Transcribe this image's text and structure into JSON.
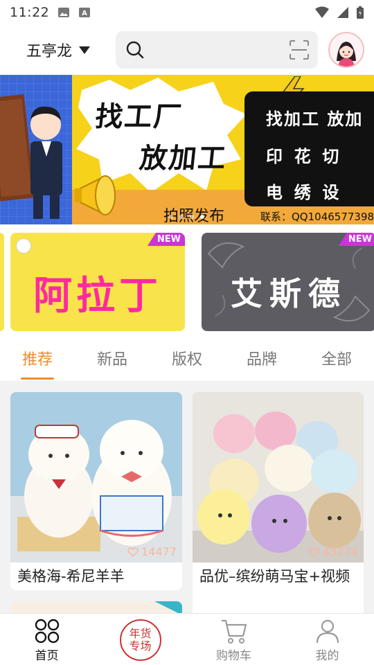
{
  "status_bar": {
    "time": "11:22"
  },
  "header": {
    "location": "五亭龙",
    "search_placeholder": ""
  },
  "banner": {
    "line1": "找工厂",
    "line2": "放加工",
    "caption": "拍照发布",
    "contact": "联系：QQ1046577398",
    "box_rows": [
      "找加工  放加",
      "印  花  切",
      "电  绣  设"
    ]
  },
  "brands": [
    {
      "name": "阿拉丁",
      "badge": "NEW"
    },
    {
      "name": "艾斯德",
      "badge": "NEW"
    }
  ],
  "tabs": [
    "推荐",
    "新品",
    "版权",
    "品牌",
    "全部"
  ],
  "active_tab": 0,
  "products": [
    {
      "title": "美格海-希尼羊羊",
      "likes": "14477"
    },
    {
      "title": "品优–缤纷萌马宝+视频",
      "likes": "43274"
    }
  ],
  "bottom_nav": {
    "home": "首页",
    "special_line1": "年货",
    "special_line2": "专场",
    "cart": "购物车",
    "mine": "我的"
  },
  "colors": {
    "accent": "#f08b2a",
    "badge": "#c936d6"
  }
}
